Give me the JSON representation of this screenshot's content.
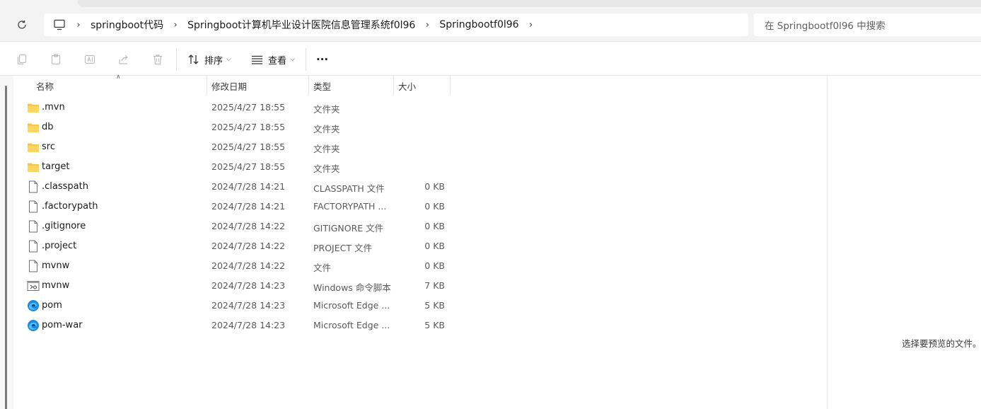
{
  "address_bar": {
    "breadcrumbs": [
      "springboot代码",
      "Springboot计算机毕业设计医院信息管理系统f0l96",
      "Springbootf0l96"
    ],
    "search_placeholder": "在 Springbootf0l96 中搜索"
  },
  "toolbar": {
    "sort_label": "排序",
    "view_label": "查看",
    "more_label": "···"
  },
  "columns": {
    "name": "名称",
    "modified": "修改日期",
    "type": "类型",
    "size": "大小"
  },
  "files": [
    {
      "name": ".mvn",
      "modified": "2025/4/27 18:55",
      "type": "文件夹",
      "size": "",
      "icon": "folder-icon"
    },
    {
      "name": "db",
      "modified": "2025/4/27 18:55",
      "type": "文件夹",
      "size": "",
      "icon": "folder-icon"
    },
    {
      "name": "src",
      "modified": "2025/4/27 18:55",
      "type": "文件夹",
      "size": "",
      "icon": "folder-icon"
    },
    {
      "name": "target",
      "modified": "2025/4/27 18:55",
      "type": "文件夹",
      "size": "",
      "icon": "folder-icon"
    },
    {
      "name": ".classpath",
      "modified": "2024/7/28 14:21",
      "type": "CLASSPATH 文件",
      "size": "0 KB",
      "icon": "file-icon"
    },
    {
      "name": ".factorypath",
      "modified": "2024/7/28 14:21",
      "type": "FACTORYPATH ...",
      "size": "0 KB",
      "icon": "file-icon"
    },
    {
      "name": ".gitignore",
      "modified": "2024/7/28 14:22",
      "type": "GITIGNORE 文件",
      "size": "0 KB",
      "icon": "file-icon"
    },
    {
      "name": ".project",
      "modified": "2024/7/28 14:22",
      "type": "PROJECT 文件",
      "size": "0 KB",
      "icon": "file-icon"
    },
    {
      "name": "mvnw",
      "modified": "2024/7/28 14:22",
      "type": "文件",
      "size": "0 KB",
      "icon": "file-icon"
    },
    {
      "name": "mvnw",
      "modified": "2024/7/28 14:23",
      "type": "Windows 命令脚本",
      "size": "7 KB",
      "icon": "script-icon"
    },
    {
      "name": "pom",
      "modified": "2024/7/28 14:23",
      "type": "Microsoft Edge ...",
      "size": "5 KB",
      "icon": "edge-icon"
    },
    {
      "name": "pom-war",
      "modified": "2024/7/28 14:23",
      "type": "Microsoft Edge ...",
      "size": "5 KB",
      "icon": "edge-icon"
    }
  ],
  "preview": {
    "message": "选择要预览的文件。"
  }
}
